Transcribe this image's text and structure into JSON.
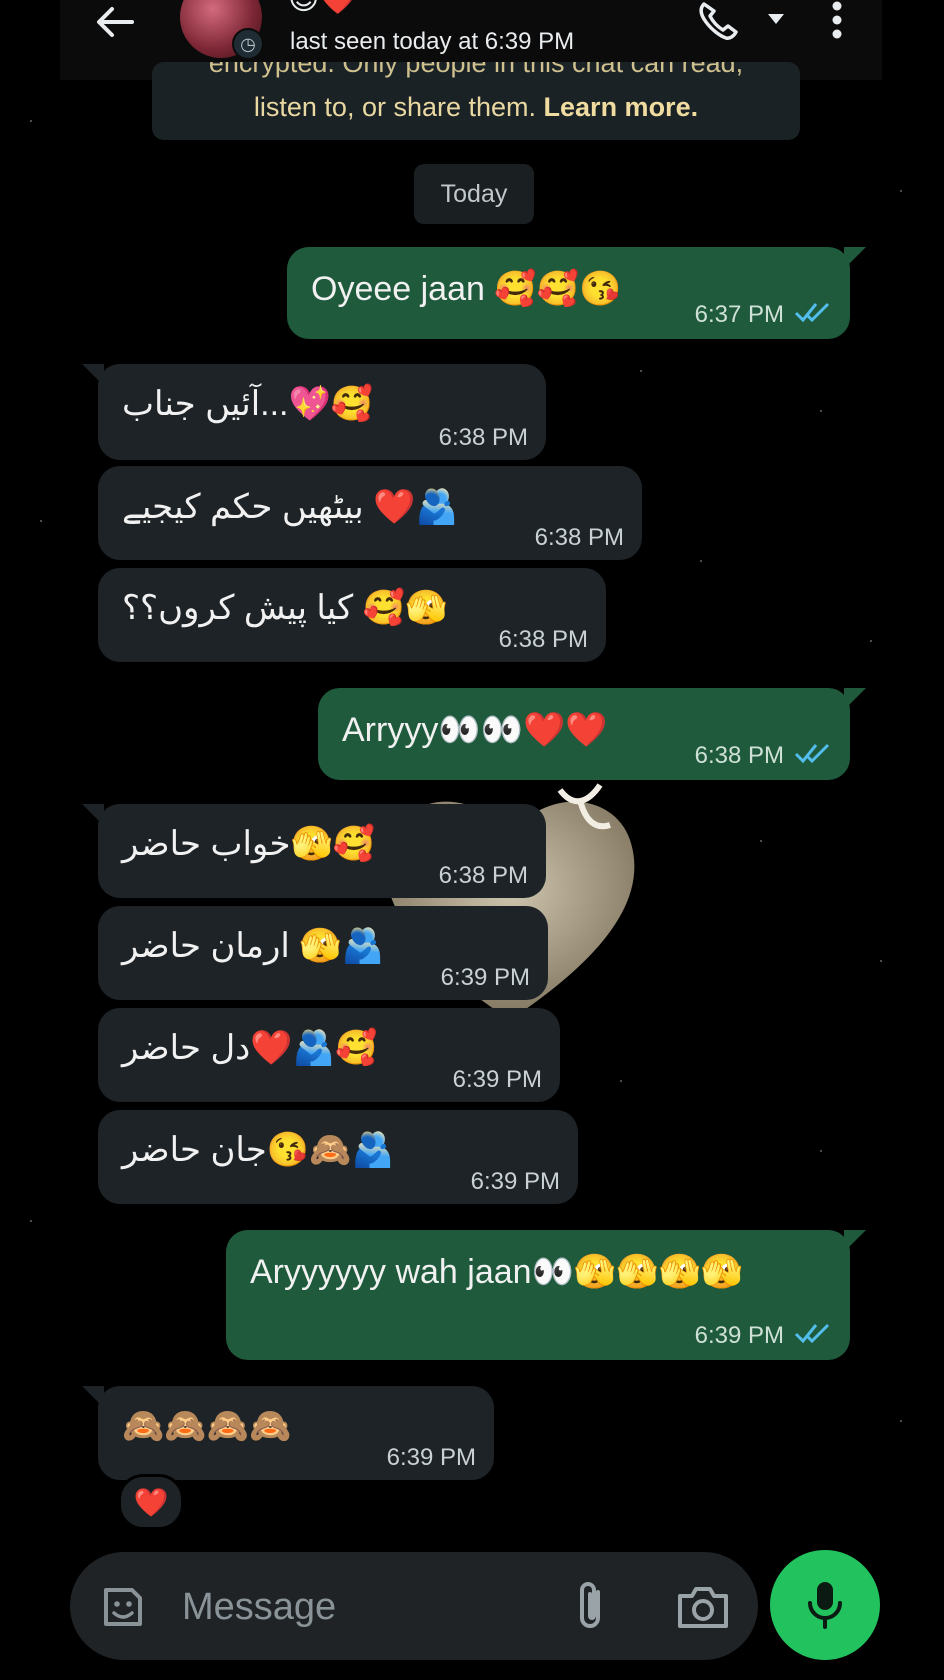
{
  "header": {
    "last_seen": "last seen today at 6:39 PM",
    "contact_emoji": "😊❤️"
  },
  "notice": {
    "line1": "encrypted. Only people in this chat can read,",
    "line2_text": "listen to, or share them. ",
    "learn_more": "Learn more."
  },
  "date_chip": "Today",
  "messages": [
    {
      "direction": "out",
      "text": "Oyeee jaan 🥰🥰😘",
      "time": "6:37 PM",
      "read": true
    },
    {
      "direction": "in",
      "text": "🥰💖...آئیں جناب",
      "time": "6:38 PM"
    },
    {
      "direction": "in",
      "text": "🫂❤️ بیٹھیں حکم کیجیے",
      "time": "6:38 PM"
    },
    {
      "direction": "in",
      "text": "🫣🥰 کیا پیش کروں؟؟",
      "time": "6:38 PM"
    },
    {
      "direction": "out",
      "text": "Arryyy👀👀❤️❤️",
      "time": "6:38 PM",
      "read": true
    },
    {
      "direction": "in",
      "text": "🥰🫣خواب حاضر",
      "time": "6:38 PM"
    },
    {
      "direction": "in",
      "text": "🫂🫣 ارمان حاضر",
      "time": "6:39 PM"
    },
    {
      "direction": "in",
      "text": "🥰🫂❤️دل حاضر",
      "time": "6:39 PM"
    },
    {
      "direction": "in",
      "text": "🫂🙈😘جان حاضر",
      "time": "6:39 PM"
    },
    {
      "direction": "out",
      "text": "Aryyyyyy wah jaan👀🫣🫣🫣🫣",
      "time": "6:39 PM",
      "read": true
    },
    {
      "direction": "in",
      "text": "🙈🙈🙈🙈",
      "time": "6:39 PM",
      "reaction": "❤️"
    }
  ],
  "input": {
    "placeholder": "Message"
  },
  "colors": {
    "outgoing_bubble": "#1e5a3b",
    "incoming_bubble": "#1d2326",
    "read_ticks": "#53bdeb",
    "mic_button": "#22c35e"
  },
  "icons": [
    "back-arrow-icon",
    "call-icon",
    "chevron-down-icon",
    "more-vert-icon",
    "emoji-icon",
    "attach-icon",
    "camera-icon",
    "mic-icon"
  ]
}
